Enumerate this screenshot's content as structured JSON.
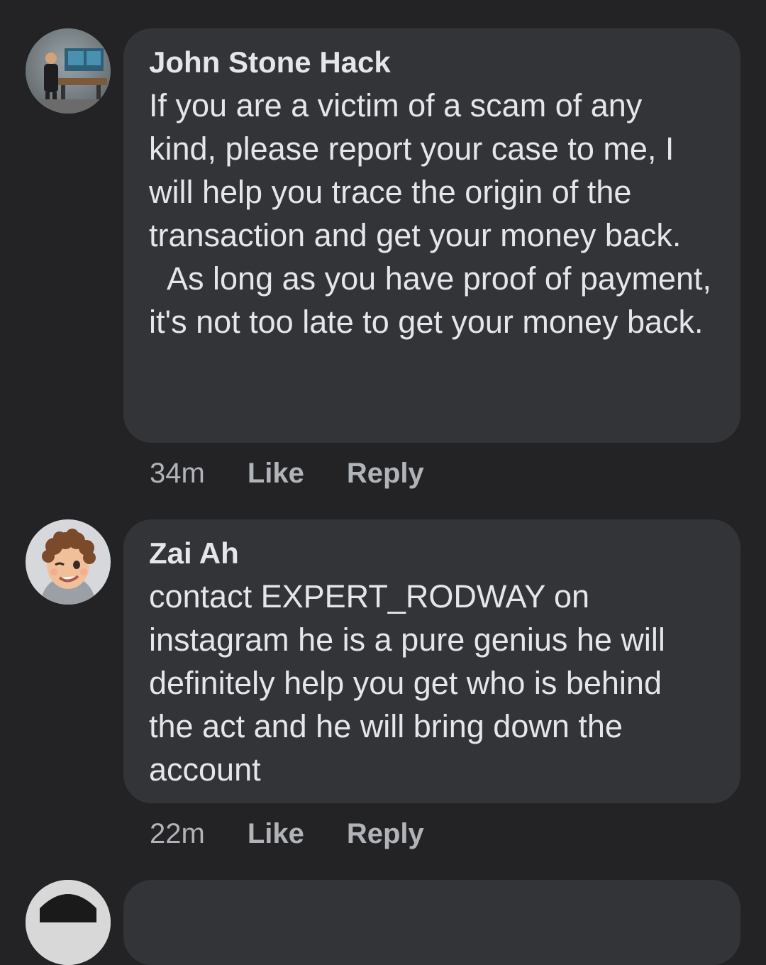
{
  "comments": [
    {
      "author": "John Stone Hack",
      "text": "If you are a victim of a scam of any kind, please report your case to me, I will help you trace the origin of the transaction and get your money back.\n  As long as you have proof of payment, it's not too late to get your money back.",
      "time": "34m",
      "like_label": "Like",
      "reply_label": "Reply",
      "avatar_icon": "profile-photo-person-at-desk"
    },
    {
      "author": "Zai Ah",
      "text": "contact EXPERT_RODWAY on instagram he is a pure genius he will definitely help you get who is behind the act and he will bring down the account",
      "time": "22m",
      "like_label": "Like",
      "reply_label": "Reply",
      "avatar_icon": "memoji-winking-face"
    }
  ],
  "colors": {
    "background": "#232326",
    "bubble": "#333437",
    "text": "#e4e6eb",
    "secondary_text": "#b0b3b8"
  }
}
